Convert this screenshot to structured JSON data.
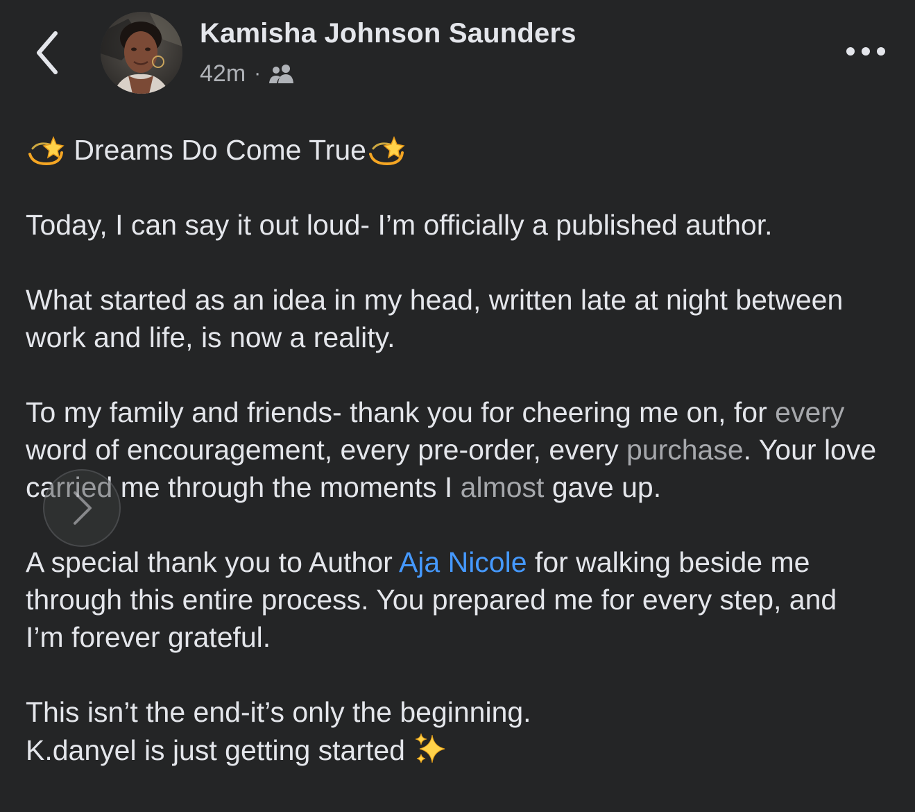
{
  "header": {
    "back_icon": "chevron-left-icon",
    "author_name": "Kamisha Johnson Saunders",
    "timestamp": "42m",
    "separator": "·",
    "audience_icon": "friends-icon",
    "more_icon": "more-horizontal-icon"
  },
  "post": {
    "title_emoji": "dizzy-star-emoji",
    "title": "Dreams Do Come True",
    "p1": "Today, I can say it out loud- I’m officially a published author.",
    "p2": "What started as an idea in my head, written late at night between work and life, is now a reality.",
    "p3_a": "To my family and friends- thank you for cheering me on, for ",
    "p3_b": "every",
    "p3_c": " word of encouragement, every pre-order, every ",
    "p3_d": "purchase",
    "p3_e": ". Your love carried me through the moments I ",
    "p3_f": "almost",
    "p3_g": " gave up.",
    "p4_a": "A special thank you to Author ",
    "p4_mention": "Aja Nicole",
    "p4_b": " for walking beside me through this entire process. You prepared me for every step, and I’m forever grateful.",
    "p5_line1": "This isn’t the end-it’s only the beginning.",
    "p5_line2": "K.danyel is just getting started",
    "sparkles_emoji": "sparkles-emoji"
  },
  "overlay": {
    "next_icon": "chevron-right-icon"
  },
  "colors": {
    "background": "#242526",
    "text": "#e4e6eb",
    "secondary_text": "#b0b3b8",
    "link": "#4599ff"
  }
}
